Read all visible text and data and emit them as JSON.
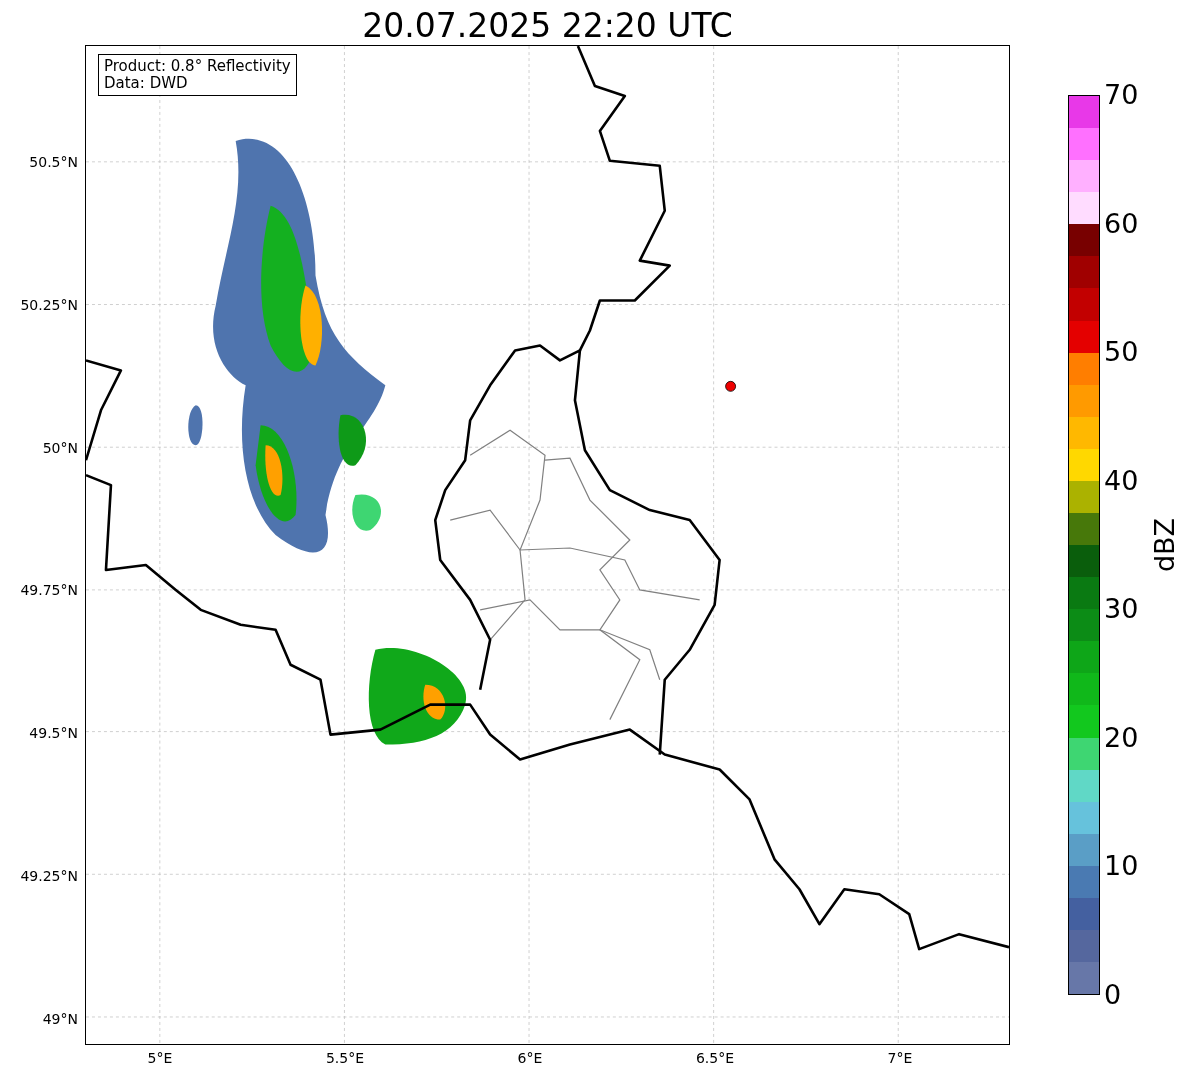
{
  "figure": {
    "title": "20.07.2025 22:20 UTC"
  },
  "map": {
    "info_box": [
      "Product: 0.8° Reflectivity",
      "Data: DWD"
    ],
    "lat_labels": [
      "50.5°N",
      "50.25°N",
      "50°N",
      "49.75°N",
      "49.5°N",
      "49.25°N",
      "49°N"
    ],
    "lon_labels": [
      "5°E",
      "5.5°E",
      "6°E",
      "6.5°E",
      "7°E"
    ]
  },
  "colorbar": {
    "label": "dBZ",
    "ticks": [
      "70",
      "60",
      "50",
      "40",
      "30",
      "20",
      "10",
      "0"
    ],
    "segments": [
      {
        "color": "#e838e8"
      },
      {
        "color": "#ff70ff"
      },
      {
        "color": "#ffb0ff"
      },
      {
        "color": "#ffdcff"
      },
      {
        "color": "#780000"
      },
      {
        "color": "#a00000"
      },
      {
        "color": "#c20000"
      },
      {
        "color": "#e40000"
      },
      {
        "color": "#ff7e00"
      },
      {
        "color": "#ff9a00"
      },
      {
        "color": "#ffb800"
      },
      {
        "color": "#ffd800"
      },
      {
        "color": "#abb200"
      },
      {
        "color": "#47780a"
      },
      {
        "color": "#0a5e0c"
      },
      {
        "color": "#0a7a12"
      },
      {
        "color": "#0c8c16"
      },
      {
        "color": "#0ea618"
      },
      {
        "color": "#10b81a"
      },
      {
        "color": "#12c81e"
      },
      {
        "color": "#3ed672"
      },
      {
        "color": "#60d8c6"
      },
      {
        "color": "#66c2dc"
      },
      {
        "color": "#5a9ec6"
      },
      {
        "color": "#4a7ab2"
      },
      {
        "color": "#4460a0"
      },
      {
        "color": "#55679e"
      },
      {
        "color": "#6777a8"
      }
    ]
  }
}
